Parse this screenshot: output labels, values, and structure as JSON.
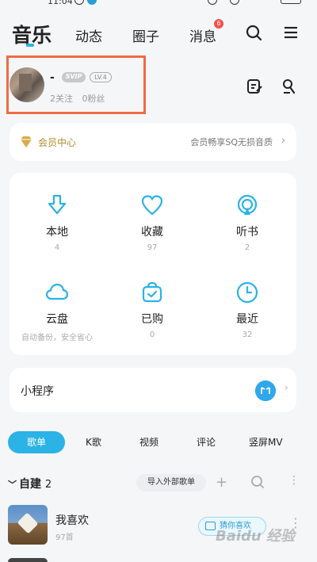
{
  "status_bar": {
    "time": "11:04"
  },
  "nav": {
    "tabs": [
      "音乐",
      "动态",
      "圈子",
      "消息"
    ],
    "message_badge": "6",
    "icons": [
      "search-icon",
      "menu-icon"
    ]
  },
  "profile": {
    "username": "-",
    "svip_label": "SVIP",
    "level": "LV.4",
    "following": "2关注",
    "followers": "0粉丝",
    "icons": [
      "edit-icon",
      "mic-icon"
    ]
  },
  "vip": {
    "title": "会员中心",
    "desc": "会员畅享SQ无损音质",
    "chevron": "›"
  },
  "grid": [
    {
      "label": "本地",
      "count": "4",
      "icon": "download-icon"
    },
    {
      "label": "收藏",
      "count": "97",
      "icon": "heart-icon"
    },
    {
      "label": "听书",
      "count": "2",
      "icon": "podcast-icon"
    },
    {
      "label": "云盘",
      "count": "自动备份，安全省心",
      "icon": "cloud-icon"
    },
    {
      "label": "已购",
      "count": "0",
      "icon": "purchased-icon"
    },
    {
      "label": "最近",
      "count": "32",
      "icon": "clock-icon"
    }
  ],
  "mini_program": {
    "title": "小程序",
    "chevron": "›"
  },
  "content_tabs": [
    "歌单",
    "K歌",
    "视频",
    "评论",
    "竖屏MV"
  ],
  "playlists": {
    "section_title": "自建",
    "section_count": "2",
    "import_label": "导入外部歌单",
    "items": [
      {
        "title": "我喜欢",
        "count": "97首",
        "guess_label": "猜你喜欢"
      }
    ]
  },
  "watermark": "Baidu 经验",
  "colors": {
    "accent": "#2bb3e6",
    "highlight_box": "#ef6b44",
    "vip_gold": "#b58c2e"
  }
}
